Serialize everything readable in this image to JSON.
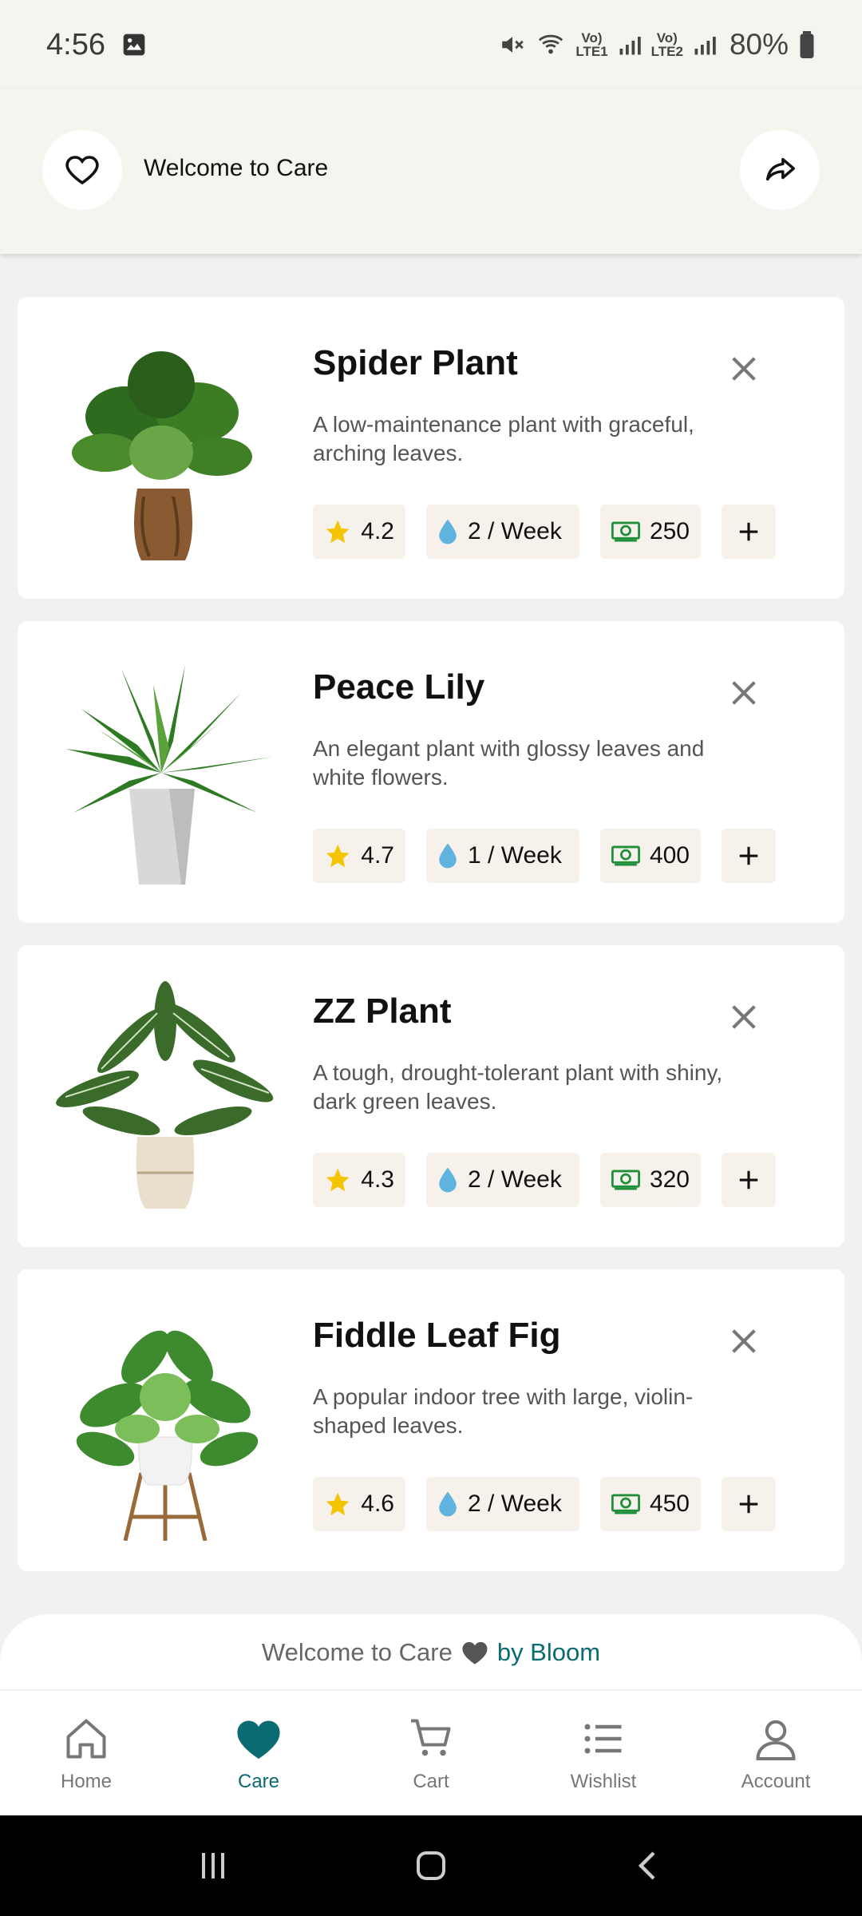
{
  "status": {
    "time": "4:56",
    "net1": "Vo)\nLTE1",
    "net2": "Vo)\nLTE2",
    "battery": "80%"
  },
  "header": {
    "title": "Welcome to Care"
  },
  "plants": [
    {
      "name": "Spider Plant",
      "desc": "A low-maintenance plant with graceful, arching leaves.",
      "rating": "4.2",
      "water": "2 / Week",
      "price": "250"
    },
    {
      "name": "Peace Lily",
      "desc": "An elegant plant with glossy leaves and white flowers.",
      "rating": "4.7",
      "water": "1 / Week",
      "price": "400"
    },
    {
      "name": "ZZ Plant",
      "desc": "A tough, drought-tolerant plant with shiny, dark green leaves.",
      "rating": "4.3",
      "water": "2 / Week",
      "price": "320"
    },
    {
      "name": "Fiddle Leaf Fig",
      "desc": "A popular indoor tree with large, violin-shaped leaves.",
      "rating": "4.6",
      "water": "2 / Week",
      "price": "450"
    }
  ],
  "footer": {
    "text": "Welcome to Care",
    "brand": "by Bloom"
  },
  "nav": {
    "items": [
      {
        "label": "Home"
      },
      {
        "label": "Care"
      },
      {
        "label": "Cart"
      },
      {
        "label": "Wishlist"
      },
      {
        "label": "Account"
      }
    ]
  },
  "colors": {
    "accent": "#0b6b73",
    "background": "#f1f1f1",
    "header_bg": "#f6f4ef",
    "chip_bg": "#f6f1ea"
  }
}
